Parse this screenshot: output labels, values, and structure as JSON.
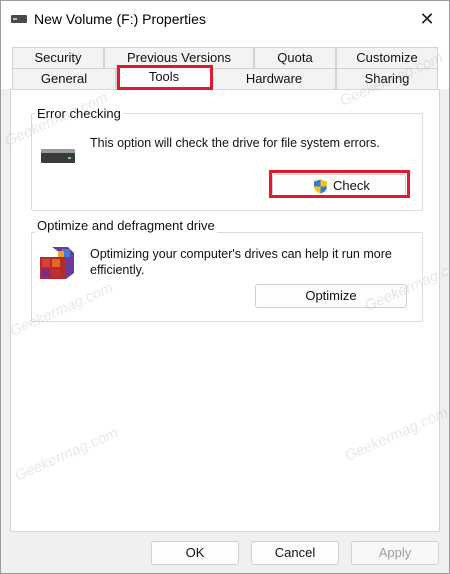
{
  "window": {
    "title": "New Volume (F:) Properties",
    "close_glyph": "✕"
  },
  "tabs": {
    "row1": [
      {
        "label": "Security"
      },
      {
        "label": "Previous Versions"
      },
      {
        "label": "Quota"
      },
      {
        "label": "Customize"
      }
    ],
    "row2": [
      {
        "label": "General"
      },
      {
        "label": "Tools",
        "active": true
      },
      {
        "label": "Hardware"
      },
      {
        "label": "Sharing"
      }
    ]
  },
  "error_checking": {
    "title": "Error checking",
    "description": "This option will check the drive for file system errors.",
    "button_label": "Check",
    "icon": "drive-icon",
    "button_icon": "uac-shield-icon"
  },
  "optimize": {
    "title": "Optimize and defragment drive",
    "description": "Optimizing your computer's drives can help it run more efficiently.",
    "button_label": "Optimize",
    "icon": "defragment-icon"
  },
  "footer": {
    "ok_label": "OK",
    "cancel_label": "Cancel",
    "apply_label": "Apply"
  },
  "watermark_text": "Geekermag.com",
  "colors": {
    "highlight": "#e0192e",
    "accent": "#0067c0"
  }
}
